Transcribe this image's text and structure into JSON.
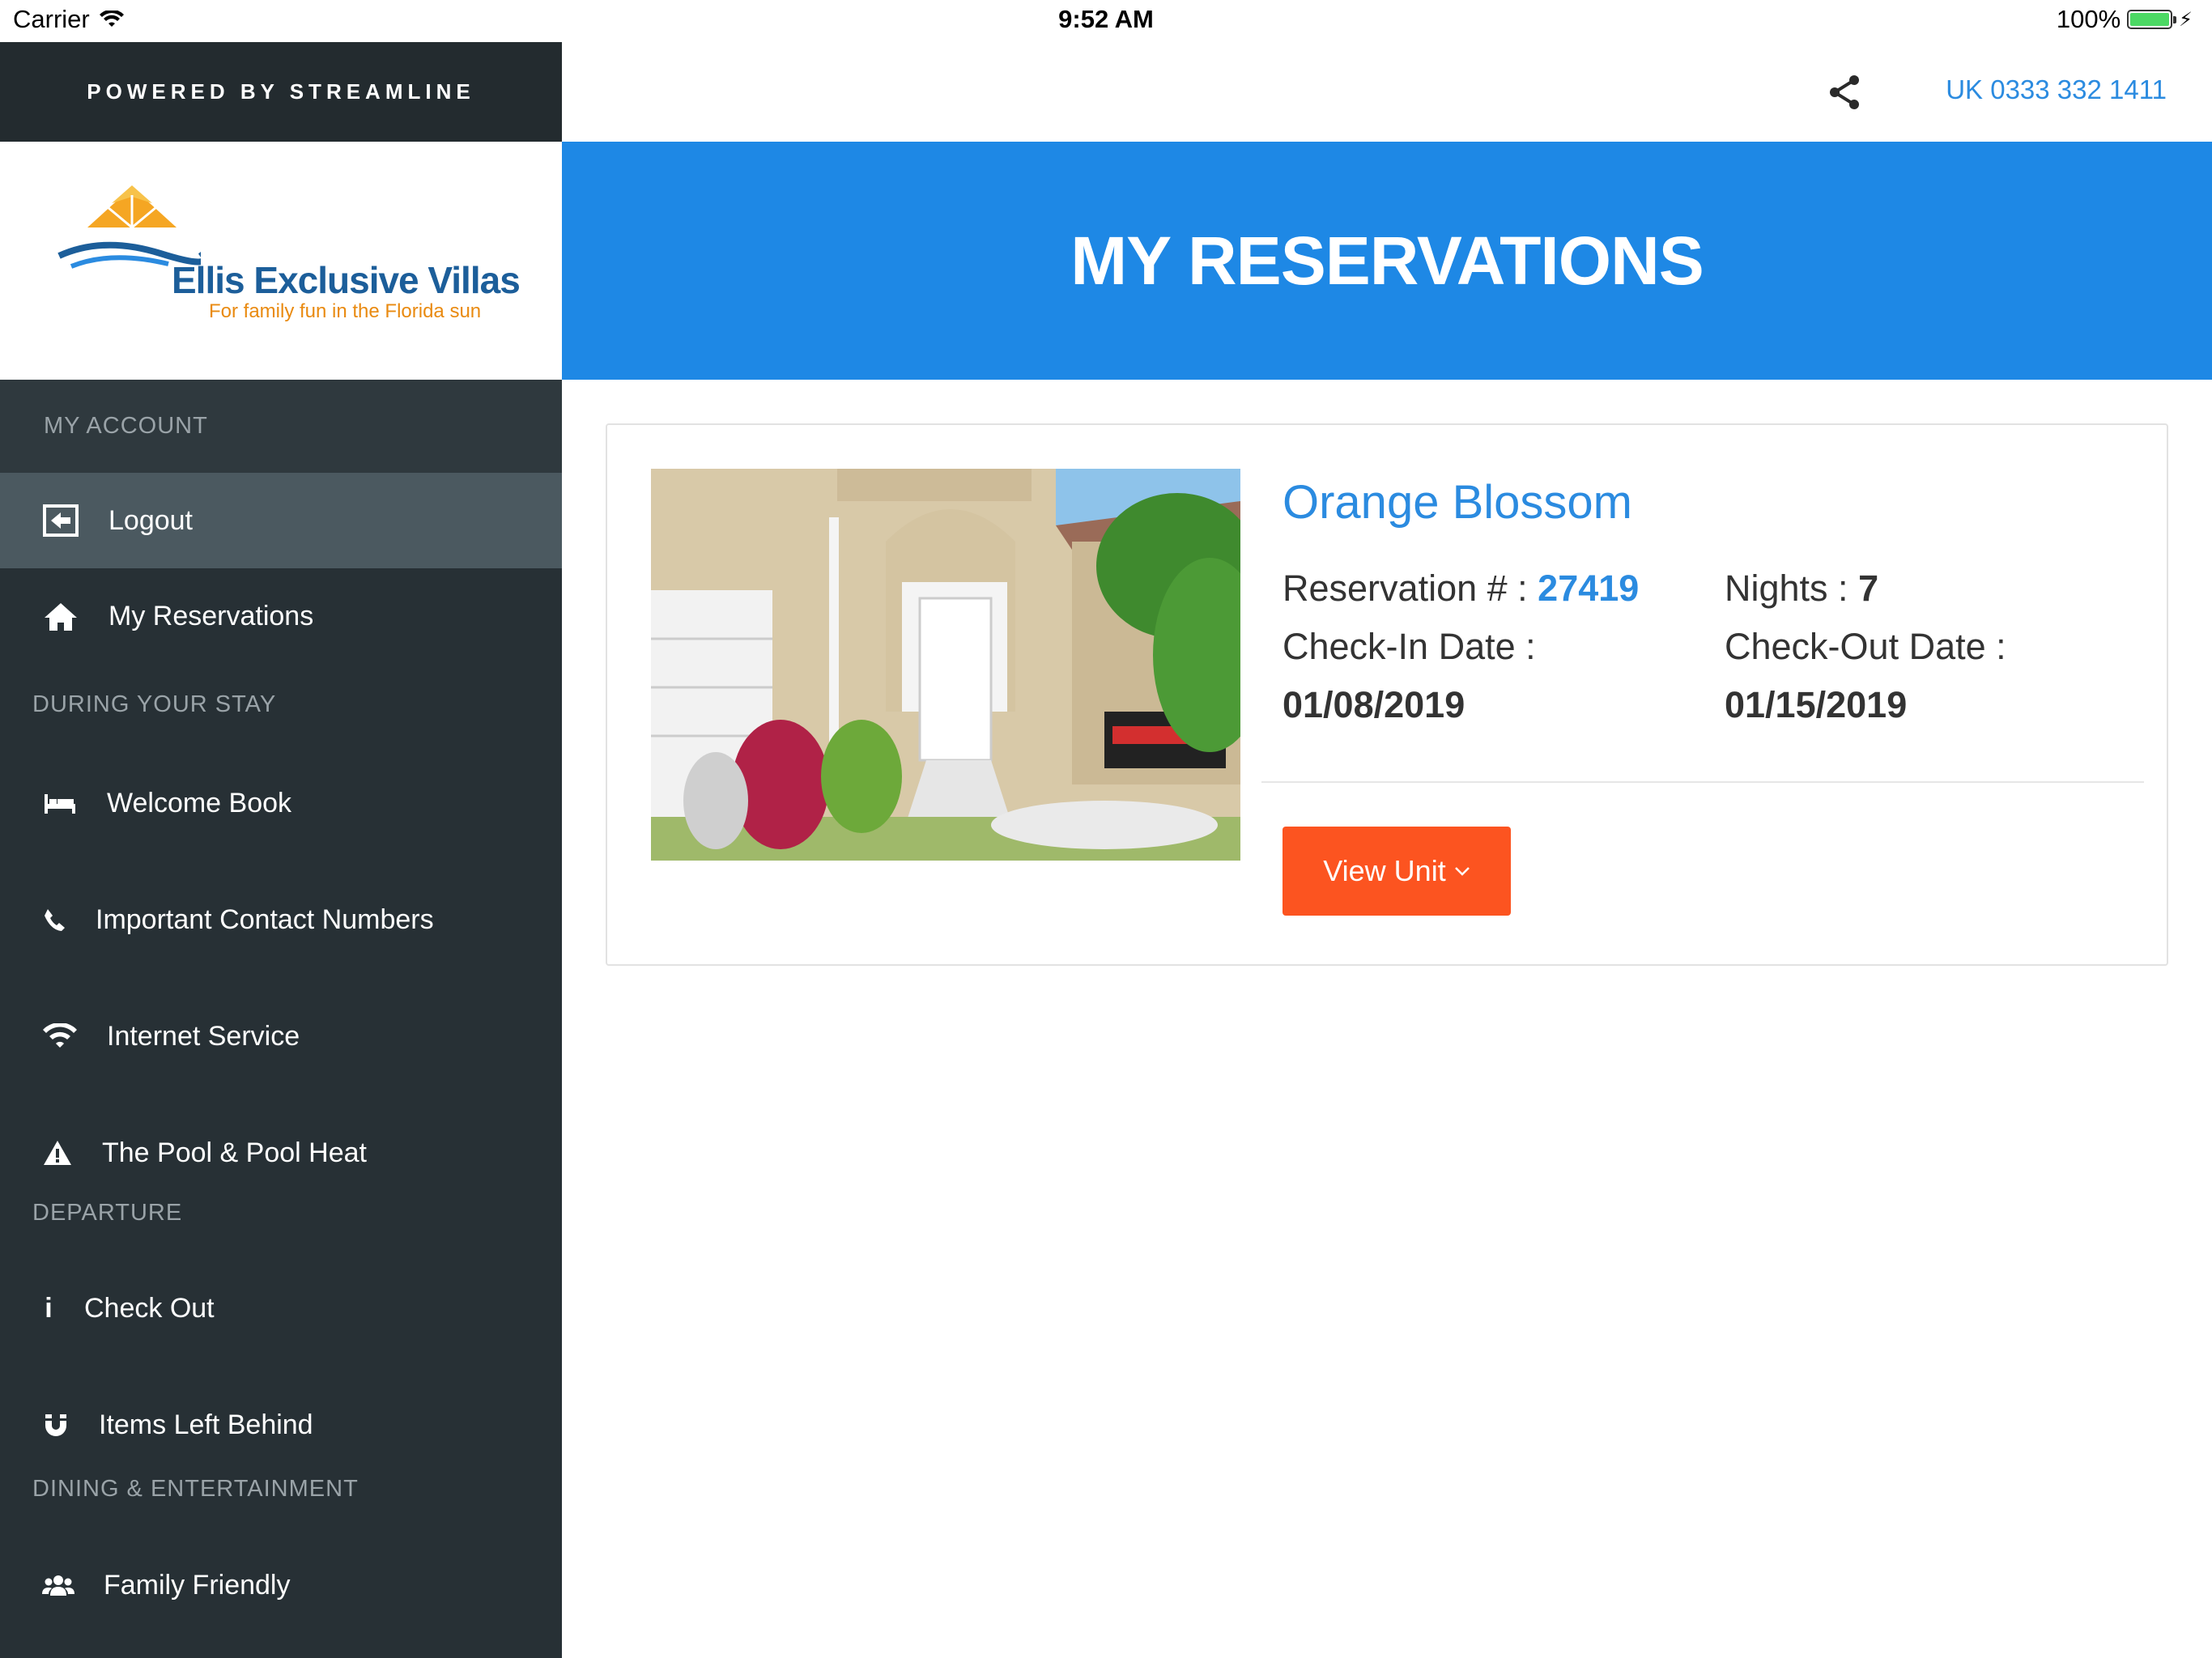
{
  "status_bar": {
    "carrier": "Carrier",
    "time": "9:52 AM",
    "battery": "100%"
  },
  "sidebar": {
    "powered_by": "POWERED BY STREAMLINE",
    "logo": {
      "title": "Ellis Exclusive Villas",
      "tagline": "For family fun in the Florida sun"
    },
    "my_account_label": "MY ACCOUNT",
    "items": [
      {
        "label": "Logout",
        "icon": "logout-icon"
      },
      {
        "label": "My Reservations",
        "icon": "home-icon"
      }
    ],
    "during_stay_label": "DURING YOUR STAY",
    "stay_items": [
      {
        "label": "Welcome Book",
        "icon": "bed-icon"
      },
      {
        "label": "Important Contact Numbers",
        "icon": "phone-icon"
      },
      {
        "label": "Internet Service",
        "icon": "wifi-icon"
      },
      {
        "label": "The Pool & Pool Heat",
        "icon": "warning-icon"
      }
    ],
    "departure_label": "DEPARTURE",
    "departure_items": [
      {
        "label": "Check Out",
        "icon": "info-icon"
      },
      {
        "label": "Items Left Behind",
        "icon": "magnet-icon"
      }
    ],
    "dining_label": "DINING & ENTERTAINMENT",
    "dining_items": [
      {
        "label": "Family Friendly",
        "icon": "users-icon"
      }
    ]
  },
  "header": {
    "phone": "UK 0333 332 1411",
    "share_icon": "share-icon"
  },
  "banner": {
    "title": "MY RESERVATIONS"
  },
  "reservation": {
    "unit_name": "Orange Blossom",
    "reservation_label": "Reservation # :",
    "reservation_number": "27419",
    "nights_label": "Nights :",
    "nights": "7",
    "checkin_label": "Check-In Date :",
    "checkin_date": "01/08/2019",
    "checkout_label": "Check-Out Date :",
    "checkout_date": "01/15/2019",
    "view_button": "View Unit"
  },
  "colors": {
    "accent": "#1e88e5",
    "link": "#2b8be0",
    "button": "#fc5420",
    "sidebar": "#273035"
  }
}
